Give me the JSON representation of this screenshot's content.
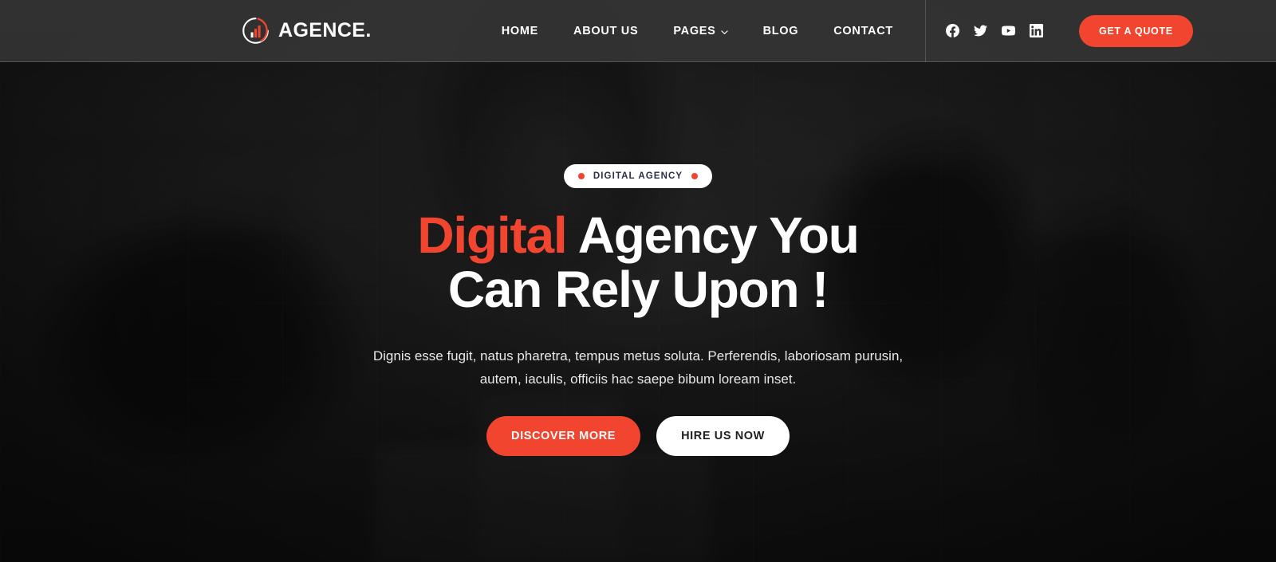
{
  "brand": {
    "name": "AGENCE.",
    "logo_icon": "bar-chart-circle-icon",
    "accent_color": "#F1452F"
  },
  "nav": {
    "items": [
      {
        "label": "HOME",
        "has_dropdown": false
      },
      {
        "label": "ABOUT US",
        "has_dropdown": false
      },
      {
        "label": "PAGES",
        "has_dropdown": true
      },
      {
        "label": "BLOG",
        "has_dropdown": false
      },
      {
        "label": "CONTACT",
        "has_dropdown": false
      }
    ]
  },
  "social": {
    "items": [
      {
        "name": "facebook-icon"
      },
      {
        "name": "twitter-icon"
      },
      {
        "name": "youtube-icon"
      },
      {
        "name": "linkedin-icon"
      }
    ]
  },
  "header": {
    "quote_button_label": "GET A QUOTE"
  },
  "hero": {
    "badge": {
      "text": "DIGITAL AGENCY",
      "dot_color": "#F1452F"
    },
    "headline": {
      "accent_word": "Digital",
      "rest_line1": " Agency You",
      "line2": "Can Rely Upon !"
    },
    "paragraph": "Dignis esse fugit, natus pharetra, tempus metus soluta. Perferendis, laboriosam purusin, autem, iaculis, officiis hac saepe bibum loream inset.",
    "primary_button_label": "DISCOVER MORE",
    "secondary_button_label": "HIRE US NOW"
  },
  "colors": {
    "accent": "#F1452F",
    "badge_text": "#2b2f45",
    "header_overlay": "#3a3a3a",
    "text_light": "#ffffff"
  }
}
